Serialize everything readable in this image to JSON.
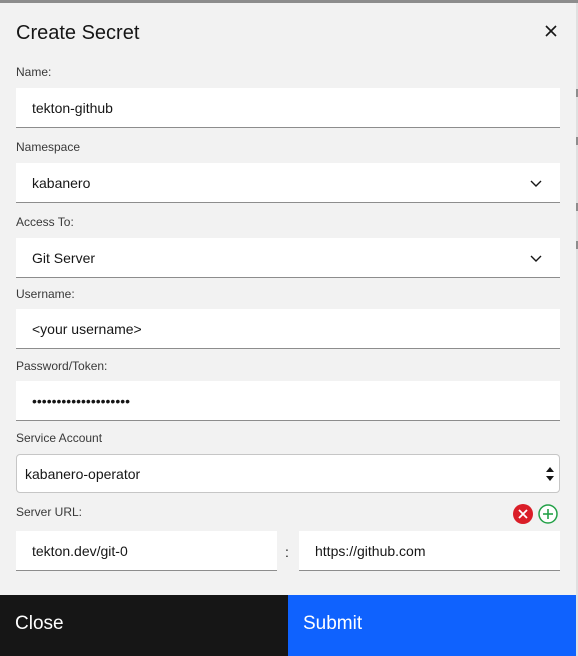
{
  "modal": {
    "title": "Create Secret"
  },
  "form": {
    "name_label": "Name:",
    "name_value": "tekton-github",
    "namespace_label": "Namespace",
    "namespace_value": "kabanero",
    "access_label": "Access To:",
    "access_value": "Git Server",
    "username_label": "Username:",
    "username_value": "<your username>",
    "password_label": "Password/Token:",
    "password_value": "••••••••••••••••••••",
    "service_account_label": "Service Account",
    "service_account_value": "kabanero-operator",
    "server_url_label": "Server URL:",
    "server_url_key": "tekton.dev/git-0",
    "server_url_separator": ":",
    "server_url_value": "https://github.com"
  },
  "footer": {
    "close_label": "Close",
    "submit_label": "Submit"
  },
  "colors": {
    "primary": "#0f62fe",
    "dark": "#161616",
    "remove": "#da1e28",
    "add": "#24a148"
  },
  "icons": [
    "close-icon",
    "chevron-down-icon",
    "select-arrows-icon",
    "remove-circle-icon",
    "add-circle-icon"
  ]
}
